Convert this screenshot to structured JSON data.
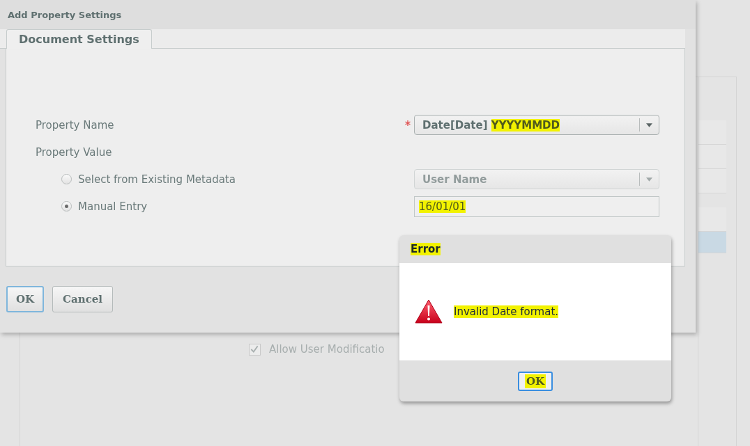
{
  "background": {
    "checkbox": {
      "label": "Allow User Modificatio",
      "checked": true,
      "disabled": true
    }
  },
  "dialog": {
    "title": "Add Property Settings",
    "tabs": [
      {
        "label": "Document Settings",
        "selected": true
      }
    ],
    "fields": [
      {
        "kind": "select",
        "label": "Property Name",
        "required": true,
        "value": "Date[Date]",
        "highlighted_value": "YYYYMMDD",
        "disabled": false
      },
      {
        "kind": "heading",
        "label": "Property Value"
      },
      {
        "kind": "radio-select",
        "label": "Select from Existing Metadata",
        "selected": false,
        "value": "User Name",
        "disabled": true
      },
      {
        "kind": "radio-input",
        "label": "Manual Entry",
        "selected": true,
        "value": "16/01/01",
        "highlighted": true
      }
    ],
    "buttons": [
      {
        "label": "OK",
        "focused": true
      },
      {
        "label": "Cancel",
        "focused": false
      }
    ]
  },
  "error_dialog": {
    "title": "Error",
    "title_highlighted": true,
    "message": "Invalid Date format.",
    "message_highlighted": true,
    "buttons": [
      {
        "label": "OK",
        "focused": true,
        "highlighted": true
      }
    ]
  }
}
